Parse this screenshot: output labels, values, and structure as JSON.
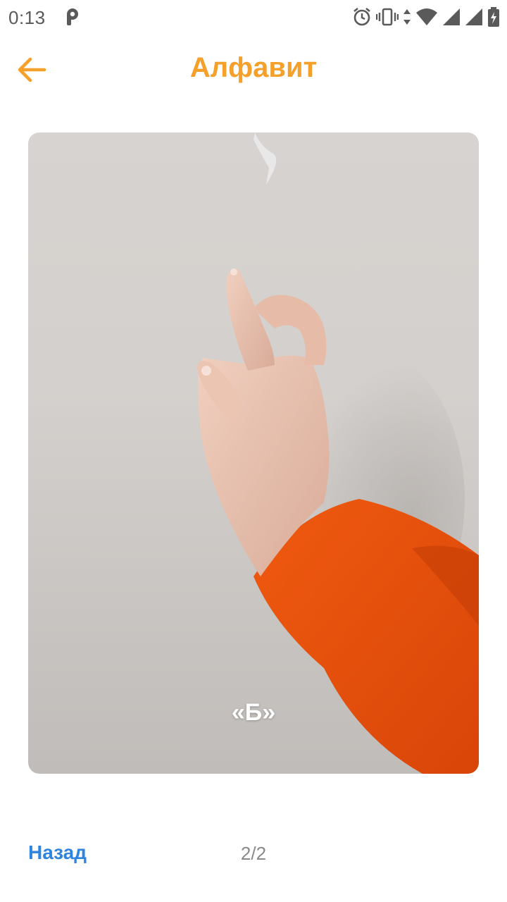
{
  "status_bar": {
    "time": "0:13",
    "icons": [
      "parking-app-icon",
      "alarm-icon",
      "vibrate-icon",
      "data-arrows-icon",
      "wifi-icon",
      "signal-icon",
      "signal-icon-2",
      "battery-charging-icon"
    ]
  },
  "header": {
    "title": "Алфавит",
    "back_icon": "arrow-left-icon",
    "accent_color": "#f5a02a"
  },
  "card": {
    "image_alt": "Жест руки для буквы",
    "caption": "«Б»"
  },
  "footer": {
    "back_label": "Назад",
    "back_color": "#2f84e0",
    "page_indicator": "2/2"
  }
}
